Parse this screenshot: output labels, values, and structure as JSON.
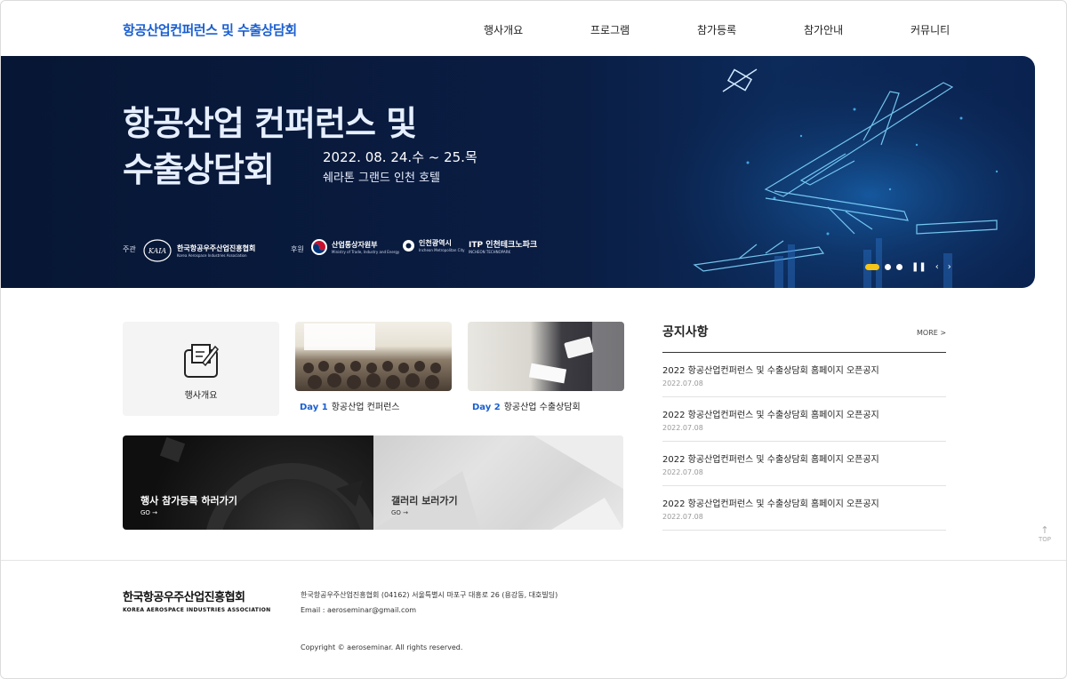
{
  "header": {
    "site_title": "항공산업컨퍼런스 및 수출상담회",
    "nav": [
      "행사개요",
      "프로그램",
      "참가등록",
      "참가안내",
      "커뮤니티"
    ]
  },
  "hero": {
    "title_line1": "항공산업 컨퍼런스 및",
    "title_line2": "수출상담회",
    "date": "2022. 08. 24.수 ~ 25.목",
    "venue": "쉐라톤 그랜드 인천 호텔",
    "host_label": "주관",
    "host_org": "한국항공우주산업진흥협회",
    "host_org_en": "Korea Aerospace Industries Association",
    "sponsor_label": "후원",
    "sponsors": [
      "산업통상자원부",
      "인천광역시",
      "ITP 인천테크노파크"
    ],
    "sponsor_subs": [
      "Ministry of Trade, Industry and Energy",
      "Incheon Metropolitan City",
      "INCHEON TECHNOPARK"
    ],
    "slides_total": 3,
    "slide_active": 1
  },
  "cards": {
    "intro_label": "행사개요",
    "day1_tag": "Day 1",
    "day1_label": "항공산업 컨퍼런스",
    "day2_tag": "Day 2",
    "day2_label": "항공산업 수출상담회",
    "register_title": "행사 참가등록 하러가기",
    "register_go": "GO →",
    "gallery_title": "갤러리 보러가기",
    "gallery_go": "GO →"
  },
  "notice": {
    "title": "공지사항",
    "more": "MORE >",
    "items": [
      {
        "title": "2022 항공산업컨퍼런스 및 수출상담회 홈페이지 오픈공지",
        "date": "2022.07.08"
      },
      {
        "title": "2022 항공산업컨퍼런스 및 수출상담회 홈페이지 오픈공지",
        "date": "2022.07.08"
      },
      {
        "title": "2022 항공산업컨퍼런스 및 수출상담회 홈페이지 오픈공지",
        "date": "2022.07.08"
      },
      {
        "title": "2022 항공산업컨퍼런스 및 수출상담회 홈페이지 오픈공지",
        "date": "2022.07.08"
      }
    ]
  },
  "top_button": {
    "arrow": "↑",
    "label": "TOP"
  },
  "footer": {
    "org_name": "한국항공우주산업진흥협회",
    "org_name_en": "KOREA AEROSPACE INDUSTRIES ASSOCIATION",
    "address": "한국항공우주산업진흥협회   (04162) 서울특별시 마포구 대흥로 26 (용강동, 대호빌딩)",
    "email": "Email : aeroseminar@gmail.com",
    "copyright": "Copyright © aeroseminar. All rights reserved."
  },
  "colors": {
    "brand": "#1a5fd0",
    "hero_bg": "#071634",
    "active_dot": "#f5c518"
  }
}
